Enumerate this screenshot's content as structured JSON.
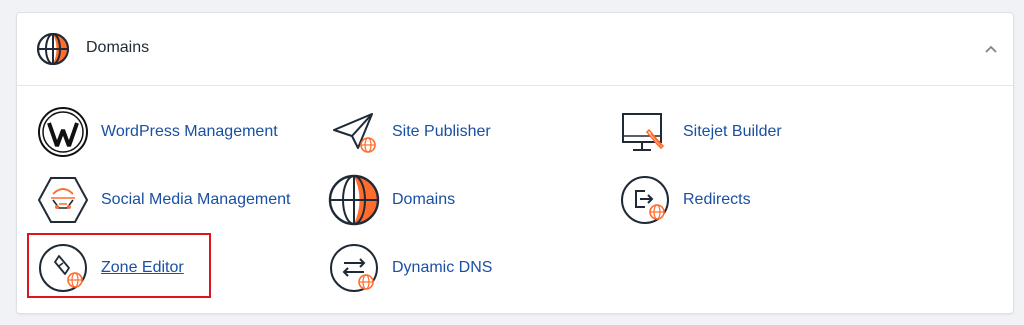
{
  "section": {
    "title": "Domains",
    "collapse_icon": "chevron-up-icon"
  },
  "items": [
    {
      "label": "WordPress Management",
      "icon": "wordpress-icon"
    },
    {
      "label": "Site Publisher",
      "icon": "paper-plane-icon"
    },
    {
      "label": "Sitejet Builder",
      "icon": "monitor-pen-icon"
    },
    {
      "label": "Social Media Management",
      "icon": "social-media-icon"
    },
    {
      "label": "Domains",
      "icon": "globe-icon"
    },
    {
      "label": "Redirects",
      "icon": "redirect-icon"
    },
    {
      "label": "Zone Editor",
      "icon": "zone-editor-icon"
    },
    {
      "label": "Dynamic DNS",
      "icon": "dynamic-dns-icon"
    }
  ],
  "colors": {
    "link": "#1a4fa3",
    "accent": "#ff6c2c",
    "highlight": "#d9161e"
  }
}
